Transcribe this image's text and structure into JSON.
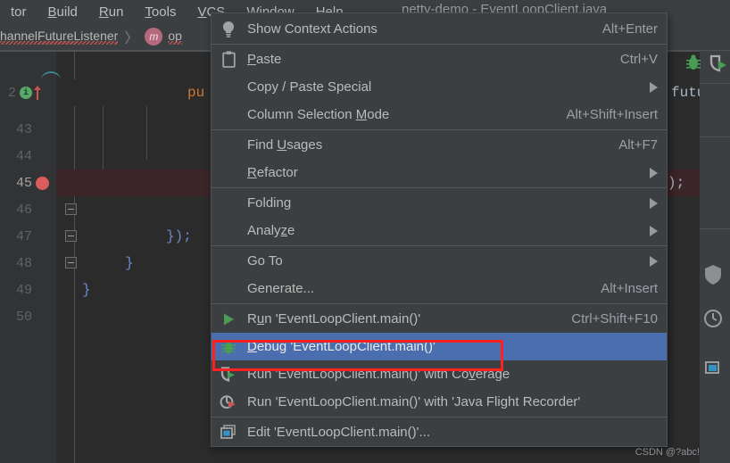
{
  "window": {
    "title": "netty-demo - EventLoopClient.java"
  },
  "menubar": {
    "items": [
      {
        "label": "tor",
        "mnemonic": ""
      },
      {
        "label": "Build",
        "mnemonic": "B"
      },
      {
        "label": "Run",
        "mnemonic": "R"
      },
      {
        "label": "Tools",
        "mnemonic": "T"
      },
      {
        "label": "VCS",
        "mnemonic": "V"
      },
      {
        "label": "Window",
        "mnemonic": "W"
      },
      {
        "label": "Help",
        "mnemonic": "H"
      }
    ]
  },
  "breadcrumb": {
    "class_part": "hannelFutureListener",
    "separator": "〉",
    "method_icon_letter": "m",
    "method_part": "op"
  },
  "editor": {
    "code_header_line_number": "2",
    "code_header_keyword": "pu",
    "right_code_fragment": "future",
    "gutter_lines": [
      {
        "number": "43",
        "breakpoint": false,
        "fold": false,
        "code": ""
      },
      {
        "number": "44",
        "breakpoint": false,
        "fold": false,
        "code": ""
      },
      {
        "number": "45",
        "breakpoint": true,
        "fold": false,
        "code": "",
        "highlight": true
      },
      {
        "number": "46",
        "breakpoint": false,
        "fold": true,
        "code": ""
      },
      {
        "number": "47",
        "breakpoint": false,
        "fold": true,
        "code": "});"
      },
      {
        "number": "48",
        "breakpoint": false,
        "fold": true,
        "code": "}"
      },
      {
        "number": "49",
        "breakpoint": false,
        "fold": false,
        "code": "}"
      },
      {
        "number": "50",
        "breakpoint": false,
        "fold": false,
        "code": ""
      }
    ],
    "line_47_code": "});",
    "line_48_code": "}",
    "line_49_code": "}",
    "tail_fragment": ");"
  },
  "context_menu": {
    "items": [
      {
        "id": "show-context-actions",
        "icon": "lightbulb-icon",
        "label": "Show Context Actions",
        "mnemonic": "",
        "shortcut": "Alt+Enter",
        "submenu": false,
        "selected": false
      },
      {
        "id": "separator-1",
        "type": "separator"
      },
      {
        "id": "paste",
        "icon": "clipboard-icon",
        "label": "Paste",
        "mnemonic": "P",
        "shortcut": "Ctrl+V",
        "submenu": false,
        "selected": false
      },
      {
        "id": "copy-paste-special",
        "icon": "",
        "label": "Copy / Paste Special",
        "mnemonic": "",
        "shortcut": "",
        "submenu": true,
        "selected": false
      },
      {
        "id": "column-selection-mode",
        "icon": "",
        "label": "Column Selection Mode",
        "mnemonic": "M",
        "shortcut": "Alt+Shift+Insert",
        "submenu": false,
        "selected": false
      },
      {
        "id": "separator-2",
        "type": "separator"
      },
      {
        "id": "find-usages",
        "icon": "",
        "label": "Find Usages",
        "mnemonic": "U",
        "shortcut": "Alt+F7",
        "submenu": false,
        "selected": false
      },
      {
        "id": "refactor",
        "icon": "",
        "label": "Refactor",
        "mnemonic": "R",
        "shortcut": "",
        "submenu": true,
        "selected": false
      },
      {
        "id": "separator-3",
        "type": "separator"
      },
      {
        "id": "folding",
        "icon": "",
        "label": "Folding",
        "mnemonic": "",
        "shortcut": "",
        "submenu": true,
        "selected": false
      },
      {
        "id": "analyze",
        "icon": "",
        "label": "Analyze",
        "mnemonic": "z",
        "shortcut": "",
        "submenu": true,
        "selected": false
      },
      {
        "id": "separator-4",
        "type": "separator"
      },
      {
        "id": "go-to",
        "icon": "",
        "label": "Go To",
        "mnemonic": "",
        "shortcut": "",
        "submenu": true,
        "selected": false
      },
      {
        "id": "generate",
        "icon": "",
        "label": "Generate...",
        "mnemonic": "",
        "shortcut": "Alt+Insert",
        "submenu": false,
        "selected": false
      },
      {
        "id": "separator-5",
        "type": "separator"
      },
      {
        "id": "run-main",
        "icon": "run-icon",
        "label": "Run 'EventLoopClient.main()'",
        "mnemonic": "u",
        "shortcut": "Ctrl+Shift+F10",
        "submenu": false,
        "selected": false
      },
      {
        "id": "debug-main",
        "icon": "debug-icon",
        "label": "Debug 'EventLoopClient.main()'",
        "mnemonic": "D",
        "shortcut": "",
        "submenu": false,
        "selected": true
      },
      {
        "id": "run-with-coverage",
        "icon": "coverage-icon",
        "label": "Run 'EventLoopClient.main()' with Coverage",
        "mnemonic": "v",
        "shortcut": "",
        "submenu": false,
        "selected": false
      },
      {
        "id": "run-with-jfr",
        "icon": "profiler-icon",
        "label": "Run 'EventLoopClient.main()' with 'Java Flight Recorder'",
        "mnemonic": "",
        "shortcut": "",
        "submenu": false,
        "selected": false
      },
      {
        "id": "separator-6",
        "type": "separator"
      },
      {
        "id": "edit-configuration",
        "icon": "edit-config-icon",
        "label": "Edit 'EventLoopClient.main()'...",
        "mnemonic": "",
        "shortcut": "",
        "submenu": false,
        "selected": false
      }
    ]
  },
  "annotation": {
    "highlight_color": "#ff2020",
    "selection_color": "#4b6eaf"
  },
  "watermark": {
    "text": "CSDN @?abc!"
  }
}
